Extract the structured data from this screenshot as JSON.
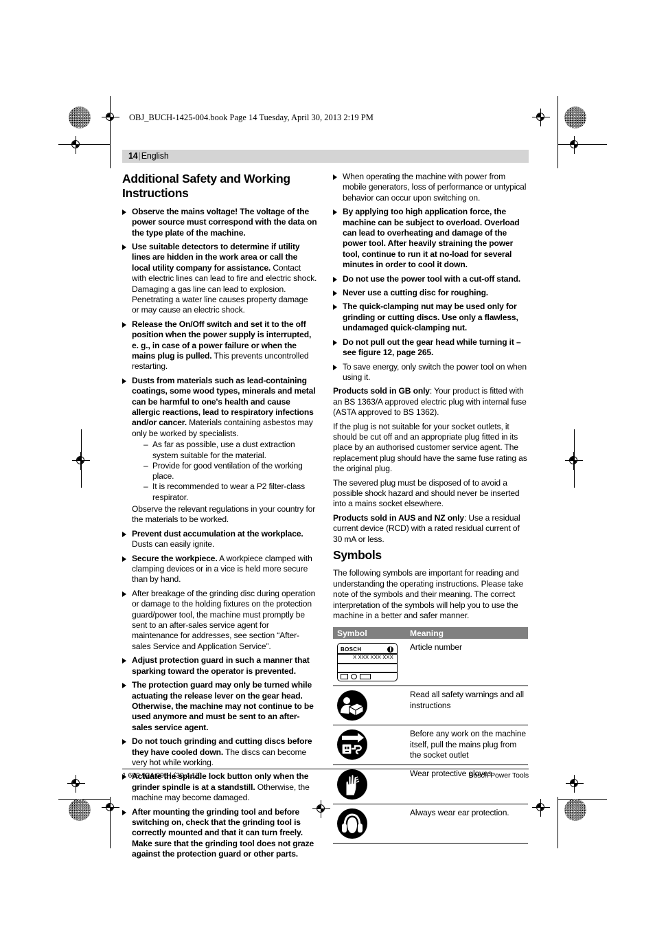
{
  "file_header": "OBJ_BUCH-1425-004.book  Page 14  Tuesday, April 30, 2013  2:19 PM",
  "page_header": {
    "number": "14",
    "separator": "|",
    "language": "English"
  },
  "left_column": {
    "heading": "Additional Safety and Working Instructions",
    "items": [
      {
        "bold": "Observe the mains voltage! The voltage of the power source must correspond with the data on the type plate of the machine.",
        "rest": ""
      },
      {
        "bold": "Use suitable detectors to determine if utility lines are hidden in the work area or call the local utility company for assistance.",
        "rest": " Contact with electric lines can lead to fire and electric shock. Damaging a gas line can lead to explosion. Penetrating a water line causes property damage or may cause an electric shock."
      },
      {
        "bold": "Release the On/Off switch and set it to the off position when the power supply is interrupted, e. g., in case of a power failure or when the mains plug is pulled.",
        "rest": " This prevents uncontrolled restarting."
      },
      {
        "bold": "Dusts from materials such as lead-containing coatings, some wood types, minerals and metal can be harmful to one's health and cause allergic reactions, lead to respiratory infections and/or cancer.",
        "rest": " Materials containing asbestos may only be worked by specialists.",
        "sub_items": [
          "As far as possible, use a dust extraction system suitable for the material.",
          "Provide for good ventilation of the working place.",
          "It is recommended to wear a P2 filter-class respirator."
        ],
        "after": "Observe the relevant regulations in your country for the materials to be worked."
      },
      {
        "bold": "Prevent dust accumulation at the workplace.",
        "rest": " Dusts can easily ignite."
      },
      {
        "bold": "Secure the workpiece.",
        "rest": " A workpiece clamped with clamping devices or in a vice is held more secure than by hand."
      },
      {
        "bold": "",
        "rest": "After breakage of the grinding disc during operation or damage to the holding fixtures on the protection guard/power tool, the machine must promptly be sent to an after-sales service agent for maintenance for addresses, see section “After-sales Service and Application Service”."
      },
      {
        "bold": "Adjust protection guard in such a manner that sparking toward the operator is prevented.",
        "rest": ""
      },
      {
        "bold": "The protection guard may only be turned while actuating the release lever on the gear head. Otherwise, the machine may not continue to be used anymore and must be sent to an after-sales service agent.",
        "rest": ""
      },
      {
        "bold": "Do not touch grinding and cutting discs before they have cooled down.",
        "rest": " The discs can become very hot while working."
      },
      {
        "bold": "Actuate the spindle lock button only when the grinder spindle is at a standstill.",
        "rest": " Otherwise, the machine may become damaged."
      },
      {
        "bold": "After mounting the grinding tool and before switching on, check that the grinding tool is correctly mounted and that it can turn freely. Make sure that the grinding tool does not graze against the protection guard or other parts.",
        "rest": ""
      }
    ]
  },
  "right_column": {
    "items": [
      {
        "bold": "",
        "rest": "When operating the machine with power from mobile generators, loss of performance or untypical behavior can occur upon switching on."
      },
      {
        "bold": "By applying too high application force, the machine can be subject to overload. Overload can lead to overheating and damage of the power tool. After heavily straining the power tool, continue to run it at no-load for several minutes in order to cool it down.",
        "rest": ""
      },
      {
        "bold": "Do not use the power tool with a cut-off stand.",
        "rest": ""
      },
      {
        "bold": "Never use a cutting disc for roughing.",
        "rest": ""
      },
      {
        "bold": "The quick-clamping nut may be used only for grinding or cutting discs. Use only a flawless, undamaged quick-clamping nut.",
        "rest": ""
      },
      {
        "bold": "Do not pull out the gear head while turning it – see figure 12, page 265.",
        "rest": ""
      },
      {
        "bold": "",
        "rest": "To save energy, only switch the power tool on when using it."
      }
    ],
    "gb_label": "Products sold in GB only",
    "gb_text": ": Your product is fitted with an BS 1363/A approved electric plug with internal fuse (ASTA approved to BS 1362).",
    "gb_para2": "If the plug is not suitable for your socket outlets, it should be cut off and an appropriate plug fitted in its place by an authorised customer service agent. The replacement plug should have the same fuse rating as the original plug.",
    "gb_para3": "The severed plug must be disposed of to avoid a possible shock hazard and should never be inserted into a mains socket elsewhere.",
    "aus_label": "Products sold in AUS and NZ only",
    "aus_text": ": Use a residual current device (RCD) with a rated residual current of 30 mA or less.",
    "symbols_heading": "Symbols",
    "symbols_intro": "The following symbols are important for reading and understanding the operating instructions. Please take note of the symbols and their meaning. The correct interpretation of the symbols will help you to use the machine in a better and safer manner.",
    "table": {
      "headers": [
        "Symbol",
        "Meaning"
      ],
      "rows": [
        {
          "icon": "bosch-nameplate-icon",
          "meaning": "Article number"
        },
        {
          "icon": "read-instructions-icon",
          "meaning": "Read all safety warnings and all instructions"
        },
        {
          "icon": "unplug-mains-icon",
          "meaning": "Before any work on the machine itself, pull the mains plug from the socket outlet"
        },
        {
          "icon": "protective-gloves-icon",
          "meaning": "Wear protective gloves"
        },
        {
          "icon": "ear-protection-icon",
          "meaning": "Always wear ear protection."
        }
      ]
    },
    "nameplate": {
      "brand": "BOSCH",
      "article": "X XXX XXX XXX"
    }
  },
  "footer": {
    "left": "1 609 92A 095 | (30.4.13)",
    "right": "Bosch Power Tools"
  },
  "colors": {
    "page_header_bg": "#d4d4d4",
    "table_header_bg": "#808080",
    "text": "#000000"
  }
}
